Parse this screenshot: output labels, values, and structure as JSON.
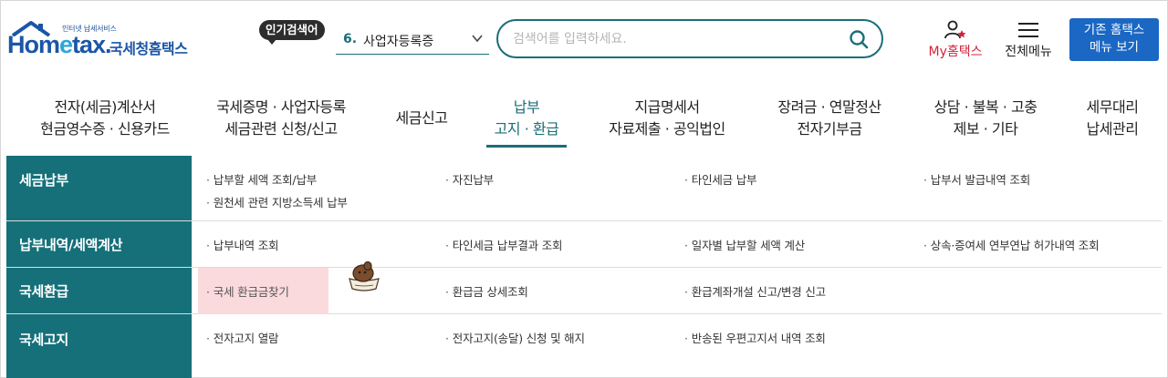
{
  "header": {
    "logo_small": "인터넷 납세서비스",
    "logo_brand_pre": "Hom",
    "logo_brand_e": "e",
    "logo_brand_post": "tax.",
    "logo_kor": "국세청홈택스",
    "popular_badge": "인기검색어",
    "popular_num": "6.",
    "popular_term": "사업자등록증",
    "search_placeholder": "검색어를 입력하세요.",
    "my_hometax": "My홈택스",
    "all_menu": "전체메뉴",
    "old_btn_line1": "기존 홈택스",
    "old_btn_line2": "메뉴 보기"
  },
  "gnb": [
    {
      "line1": "전자(세금)계산서",
      "line2": "현금영수증 · 신용카드"
    },
    {
      "line1": "국세증명 · 사업자등록",
      "line2": "세금관련 신청/신고"
    },
    {
      "line1": "세금신고",
      "line2": ""
    },
    {
      "line1": "납부",
      "line2": "고지 · 환급"
    },
    {
      "line1": "지급명세서",
      "line2": "자료제출 · 공익법인"
    },
    {
      "line1": "장려금 · 연말정산",
      "line2": "전자기부금"
    },
    {
      "line1": "상담 · 불복 · 고충",
      "line2": "제보 · 기타"
    },
    {
      "line1": "세무대리",
      "line2": "납세관리"
    }
  ],
  "sub": {
    "rows": [
      {
        "cat": "세금납부",
        "links": [
          "납부할 세액 조회/납부",
          "자진납부",
          "타인세금 납부",
          "납부서 발급내역 조회",
          "원천세 관련 지방소득세 납부"
        ]
      },
      {
        "cat": "납부내역/세액계산",
        "links": [
          "납부내역 조회",
          "타인세금 납부결과 조회",
          "일자별 납부할 세액 계산",
          "상속·증여세 연부연납 허가내역 조회"
        ]
      },
      {
        "cat": "국세환급",
        "links": [
          "국세 환급금찾기",
          "환급금 상세조회",
          "환급계좌개설 신고/변경 신고"
        ]
      },
      {
        "cat": "국세고지",
        "links": [
          "전자고지 열람",
          "전자고지(송달) 신청 및 해지",
          "반송된 우편고지서 내역 조회"
        ]
      }
    ]
  },
  "colors": {
    "accent": "#15707a",
    "brand": "#1b56a6",
    "my": "#d4223b",
    "button": "#1a67c4",
    "highlight": "#fadadd"
  }
}
